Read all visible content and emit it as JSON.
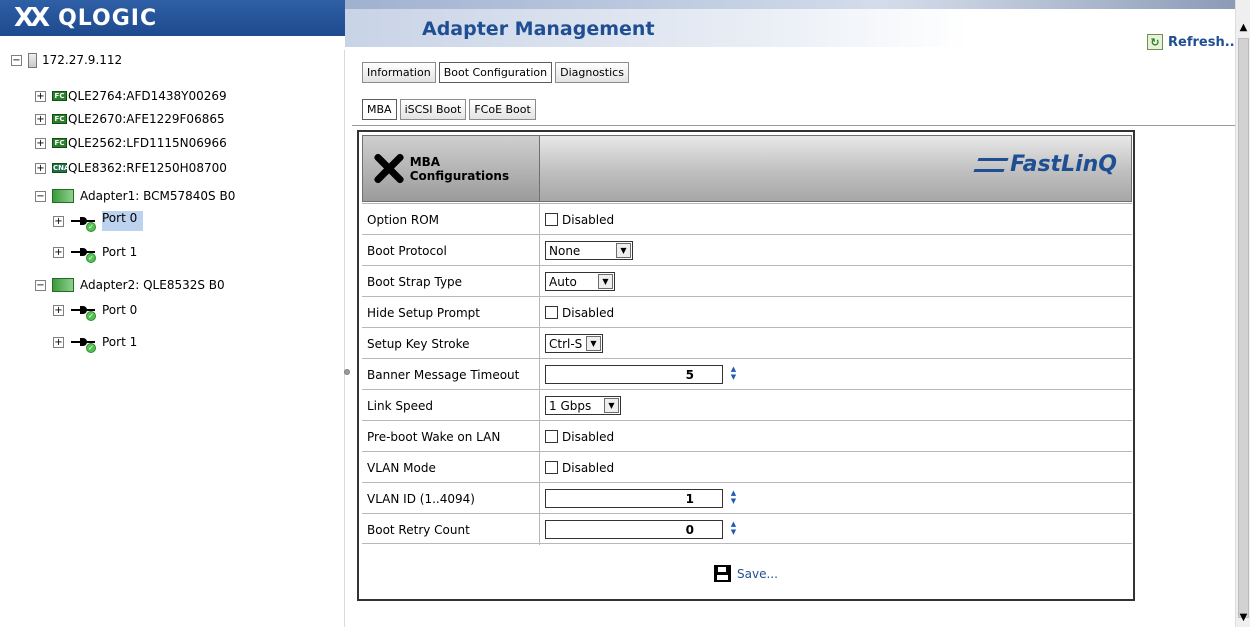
{
  "header": {
    "logo_mark": "XX",
    "logo_text": "QLOGIC",
    "app_title": "Adapter Management",
    "refresh_label": "Refresh..."
  },
  "tree": {
    "root": "172.27.9.112",
    "adapters": [
      {
        "chip": "FC",
        "label": "QLE2764:AFD1438Y00269"
      },
      {
        "chip": "FC",
        "label": "QLE2670:AFE1229F06865"
      },
      {
        "chip": "FC",
        "label": "QLE2562:LFD1115N06966"
      },
      {
        "chip": "CNA",
        "label": "QLE8362:RFE1250H08700"
      }
    ],
    "adapter1": {
      "label": "Adapter1: BCM57840S B0",
      "ports": [
        "Port 0",
        "Port 1"
      ]
    },
    "adapter2": {
      "label": "Adapter2: QLE8532S B0",
      "ports": [
        "Port 0",
        "Port 1"
      ]
    }
  },
  "tabs": [
    "Information",
    "Boot Configuration",
    "Diagnostics"
  ],
  "subtabs": [
    "MBA",
    "iSCSI Boot",
    "FCoE Boot"
  ],
  "config": {
    "header": "MBA Configurations",
    "brand": "FastLinQ",
    "rows": {
      "option_rom": {
        "label": "Option ROM",
        "value": "Disabled"
      },
      "boot_protocol": {
        "label": "Boot Protocol",
        "value": "None"
      },
      "boot_strap_type": {
        "label": "Boot Strap Type",
        "value": "Auto"
      },
      "hide_setup_prompt": {
        "label": "Hide Setup Prompt",
        "value": "Disabled"
      },
      "setup_key_stroke": {
        "label": "Setup Key Stroke",
        "value": "Ctrl-S"
      },
      "banner_message_timeout": {
        "label": "Banner Message Timeout",
        "value": "5"
      },
      "link_speed": {
        "label": "Link Speed",
        "value": "1 Gbps"
      },
      "preboot_wol": {
        "label": "Pre-boot Wake on LAN",
        "value": "Disabled"
      },
      "vlan_mode": {
        "label": "VLAN Mode",
        "value": "Disabled"
      },
      "vlan_id": {
        "label": "VLAN ID (1..4094)",
        "value": "1"
      },
      "boot_retry_count": {
        "label": "Boot Retry Count",
        "value": "0"
      }
    },
    "save_label": "Save..."
  }
}
